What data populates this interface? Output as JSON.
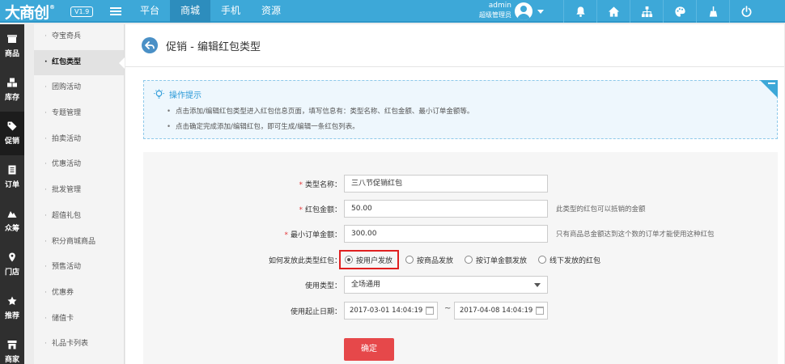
{
  "header": {
    "logo": "大商创",
    "logo_mark": "®",
    "version": "V1.9",
    "nav_tabs": [
      "平台",
      "商城",
      "手机",
      "资源"
    ],
    "active_tab": "商城",
    "user": {
      "name": "admin",
      "role": "超级管理员"
    },
    "icons": [
      "bell-icon",
      "home-icon",
      "sitemap-icon",
      "palette-icon",
      "broom-icon",
      "power-icon"
    ]
  },
  "iconbar": {
    "items": [
      {
        "label": "商品",
        "icon": "box-icon"
      },
      {
        "label": "库存",
        "icon": "cubes-icon"
      },
      {
        "label": "促销",
        "icon": "tag-icon",
        "active": true
      },
      {
        "label": "订单",
        "icon": "order-icon"
      },
      {
        "label": "众筹",
        "icon": "crowdfund-icon"
      },
      {
        "label": "门店",
        "icon": "location-icon"
      },
      {
        "label": "推荐",
        "icon": "star-icon"
      },
      {
        "label": "商家",
        "icon": "shop-icon"
      }
    ]
  },
  "submenu": {
    "items": [
      "夺宝奇兵",
      "红包类型",
      "团购活动",
      "专题管理",
      "拍卖活动",
      "优惠活动",
      "批发管理",
      "超值礼包",
      "积分商城商品",
      "预售活动",
      "优惠券",
      "储值卡",
      "礼品卡列表"
    ],
    "active": "红包类型"
  },
  "page": {
    "title": "促销 - 编辑红包类型"
  },
  "tips": {
    "title": "操作提示",
    "lines": [
      "点击添加/编辑红包类型进入红包信息页面，填写信息有：类型名称、红包金额、最小订单金额等。",
      "点击确定完成添加/编辑红包，即可生成/编辑一条红包列表。"
    ]
  },
  "form": {
    "type_name": {
      "label": "类型名称：",
      "value": "三八节促销红包"
    },
    "amount": {
      "label": "红包金额：",
      "value": "50.00",
      "hint": "此类型的红包可以抵销的金额"
    },
    "min_order": {
      "label": "最小订单金额：",
      "value": "300.00",
      "hint": "只有商品总金额达到这个数的订单才能使用这种红包"
    },
    "send_type": {
      "label": "如何发放此类型红包：",
      "options": [
        "按用户发放",
        "按商品发放",
        "按订单金额发放",
        "线下发放的红包"
      ],
      "selected": "按用户发放"
    },
    "use_type": {
      "label": "使用类型：",
      "value": "全场通用"
    },
    "date_range": {
      "label": "使用起止日期：",
      "start": "2017-03-01 14:04:19",
      "separator": "~",
      "end": "2017-04-08 14:04:19"
    },
    "submit_label": "确定"
  },
  "colors": {
    "topbar": "#3da8d8",
    "accent": "#2b9ad8",
    "submit": "#e6484a",
    "highlight": "#e01f1f"
  }
}
